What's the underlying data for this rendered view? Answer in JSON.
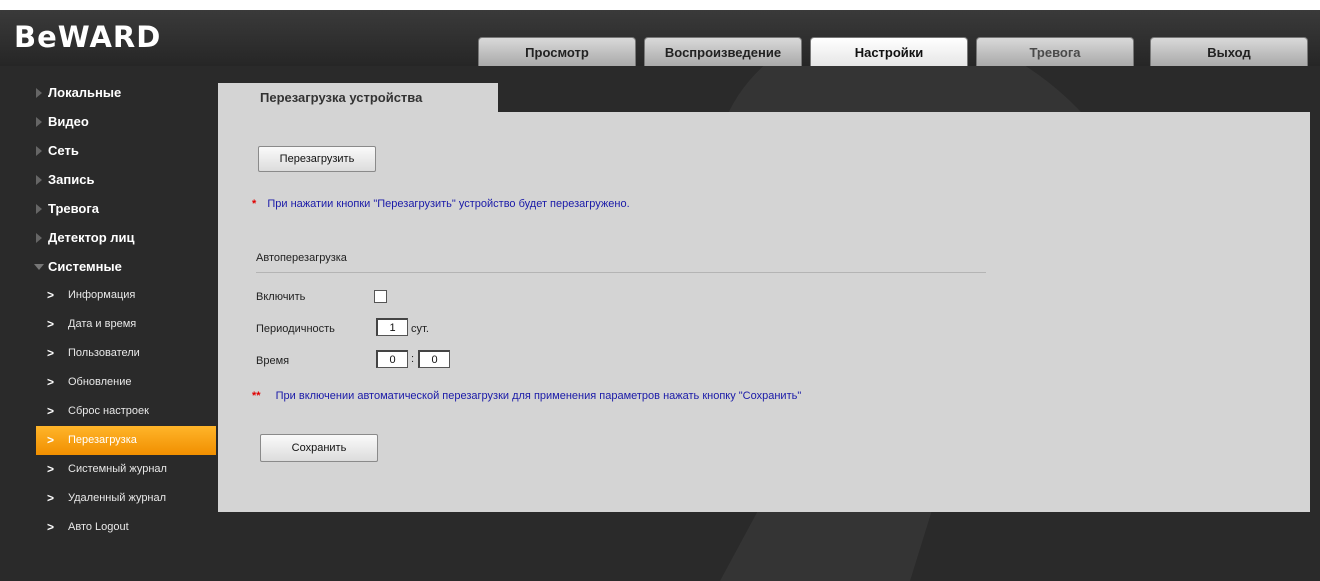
{
  "logo": "BeWARD",
  "tabs": [
    {
      "label": "Просмотр"
    },
    {
      "label": "Воспроизведение"
    },
    {
      "label": "Настройки"
    },
    {
      "label": "Тревога"
    },
    {
      "label": "Выход"
    }
  ],
  "active_tab": "Настройки",
  "sidebar": {
    "sections": [
      {
        "label": "Локальные"
      },
      {
        "label": "Видео"
      },
      {
        "label": "Сеть"
      },
      {
        "label": "Запись"
      },
      {
        "label": "Тревога"
      },
      {
        "label": "Детектор лиц"
      },
      {
        "label": "Системные"
      }
    ],
    "system_items": [
      {
        "label": "Информация"
      },
      {
        "label": "Дата и время"
      },
      {
        "label": "Пользователи"
      },
      {
        "label": "Обновление"
      },
      {
        "label": "Сброс настроек"
      },
      {
        "label": "Перезагрузка"
      },
      {
        "label": "Системный журнал"
      },
      {
        "label": "Удаленный журнал"
      },
      {
        "label": "Авто Logout"
      }
    ],
    "chevron": ">",
    "active_item": "Перезагрузка"
  },
  "page": {
    "tab_title": "Перезагрузка устройства",
    "reboot_button": "Перезагрузить",
    "reboot_note_marker": "*",
    "reboot_note": "При нажатии кнопки \"Перезагрузить\" устройство будет перезагружено.",
    "auto_section_title": "Автоперезагрузка",
    "enable_label": "Включить",
    "enable_checked": false,
    "period_label": "Периодичность",
    "period_value": "1",
    "period_unit": "сут.",
    "time_label": "Время",
    "time_hours": "0",
    "time_separator": ":",
    "time_minutes": "0",
    "auto_note_marker": "**",
    "auto_note": "При включении автоматической перезагрузки для применения параметров нажать кнопку \"Сохранить\"",
    "save_button": "Сохранить"
  },
  "colors": {
    "background": "#2a2a2a",
    "panel": "#d4d4d4",
    "accent_active": "#f59a00",
    "note_text": "#1a1aa8",
    "note_marker": "#e00000"
  }
}
